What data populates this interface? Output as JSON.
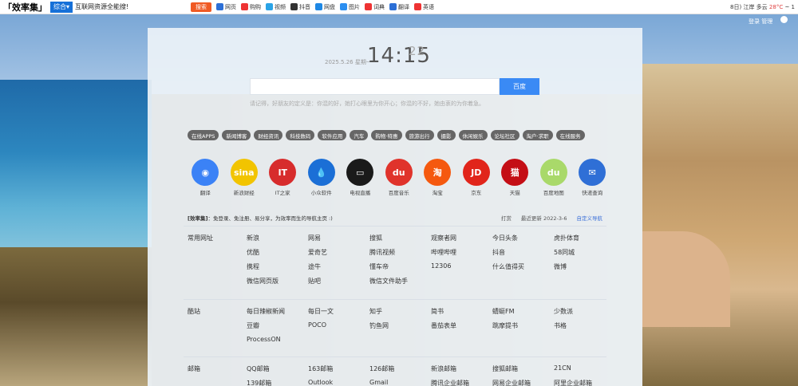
{
  "topbar": {
    "logo": "「效率集」",
    "combo": "综合",
    "tagline": "互联网资源全能搜!",
    "search_btn": "搜索",
    "sites": [
      {
        "label": "网页",
        "color": "#2c6fd6"
      },
      {
        "label": "购购",
        "color": "#e33"
      },
      {
        "label": "视频",
        "color": "#2aa3e6"
      },
      {
        "label": "抖音",
        "color": "#333"
      },
      {
        "label": "网盘",
        "color": "#1e88e5"
      },
      {
        "label": "图片",
        "color": "#2b8ef0"
      },
      {
        "label": "词典",
        "color": "#e33"
      },
      {
        "label": "翻译",
        "color": "#2c6fd6"
      },
      {
        "label": "英语",
        "color": "#e33"
      }
    ],
    "weather_prefix": "8日) 江岸 多云",
    "temp": "28°C",
    "weather_suffix": "~ 1"
  },
  "top_links": "登录  管理",
  "clock": {
    "date": "2025.5.26 星期一",
    "hm": "14:15",
    "sec": "22"
  },
  "search": {
    "button": "百度",
    "placeholder": ""
  },
  "quote": "请记得，好朋友的定义是：你混的好，她打心眼里为你开心；你混的不好，她由衷的为你着急。",
  "tags": [
    "在线APPS",
    "新闻博客",
    "财经资讯",
    "科技数码",
    "软件应用",
    "汽车",
    "购物·特惠",
    "旅游出行",
    "摄影",
    "休闲娱乐",
    "论坛社区",
    "淘户·求职",
    "在线服务"
  ],
  "apps": [
    {
      "label": "翻译",
      "color": "#3b82f6",
      "glyph": "◉"
    },
    {
      "label": "新浪财经",
      "color": "#f2c400",
      "glyph": "sina"
    },
    {
      "label": "IT之家",
      "color": "#d72c2c",
      "glyph": "IT"
    },
    {
      "label": "小众软件",
      "color": "#1b6fd6",
      "glyph": "💧"
    },
    {
      "label": "电视直播",
      "color": "#1a1a1a",
      "glyph": "▭"
    },
    {
      "label": "百度音乐",
      "color": "#e0332b",
      "glyph": "du"
    },
    {
      "label": "淘宝",
      "color": "#f5590f",
      "glyph": "淘"
    },
    {
      "label": "京东",
      "color": "#e1251b",
      "glyph": "JD"
    },
    {
      "label": "天猫",
      "color": "#c40e15",
      "glyph": "猫"
    },
    {
      "label": "百度地图",
      "color": "#a9d96a",
      "glyph": "du"
    },
    {
      "label": "快递查询",
      "color": "#2f6fd6",
      "glyph": "✉"
    }
  ],
  "notice": {
    "brand": "[效率集]",
    "text": "：免登录、免注册、易分享，为效率而生的导航主页 :)",
    "tip": "打赏",
    "updated": "最近更新 2022-3-6",
    "custom": "自定义导航"
  },
  "sections": [
    {
      "title": "常用网址",
      "items": [
        "新浪",
        "网易",
        "搜狐",
        "观察者网",
        "今日头条",
        "虎扑体育",
        "优酷",
        "爱奇艺",
        "腾讯视频",
        "哔哩哔哩",
        "抖音",
        "58同城",
        "携程",
        "途牛",
        "懂车帝",
        "12306",
        "什么值得买",
        "微博",
        "微信网页版",
        "贴吧",
        "微信文件助手"
      ]
    },
    {
      "title": "酷站",
      "items": [
        "每日辣椒新闻",
        "每日一文",
        "知乎",
        "简书",
        "蜻蜓FM",
        "少数派",
        "豆瓣",
        "POCO",
        "钓鱼网",
        "番茄表单",
        "跳摩提书",
        "书格",
        "ProcessON"
      ]
    },
    {
      "title": "邮箱",
      "items": [
        "QQ邮箱",
        "163邮箱",
        "126邮箱",
        "新浪邮箱",
        "搜狐邮箱",
        "21CN",
        "139邮箱",
        "Outlook",
        "Gmail",
        "腾讯企业邮箱",
        "网易企业邮箱",
        "阿里企业邮箱"
      ]
    }
  ]
}
